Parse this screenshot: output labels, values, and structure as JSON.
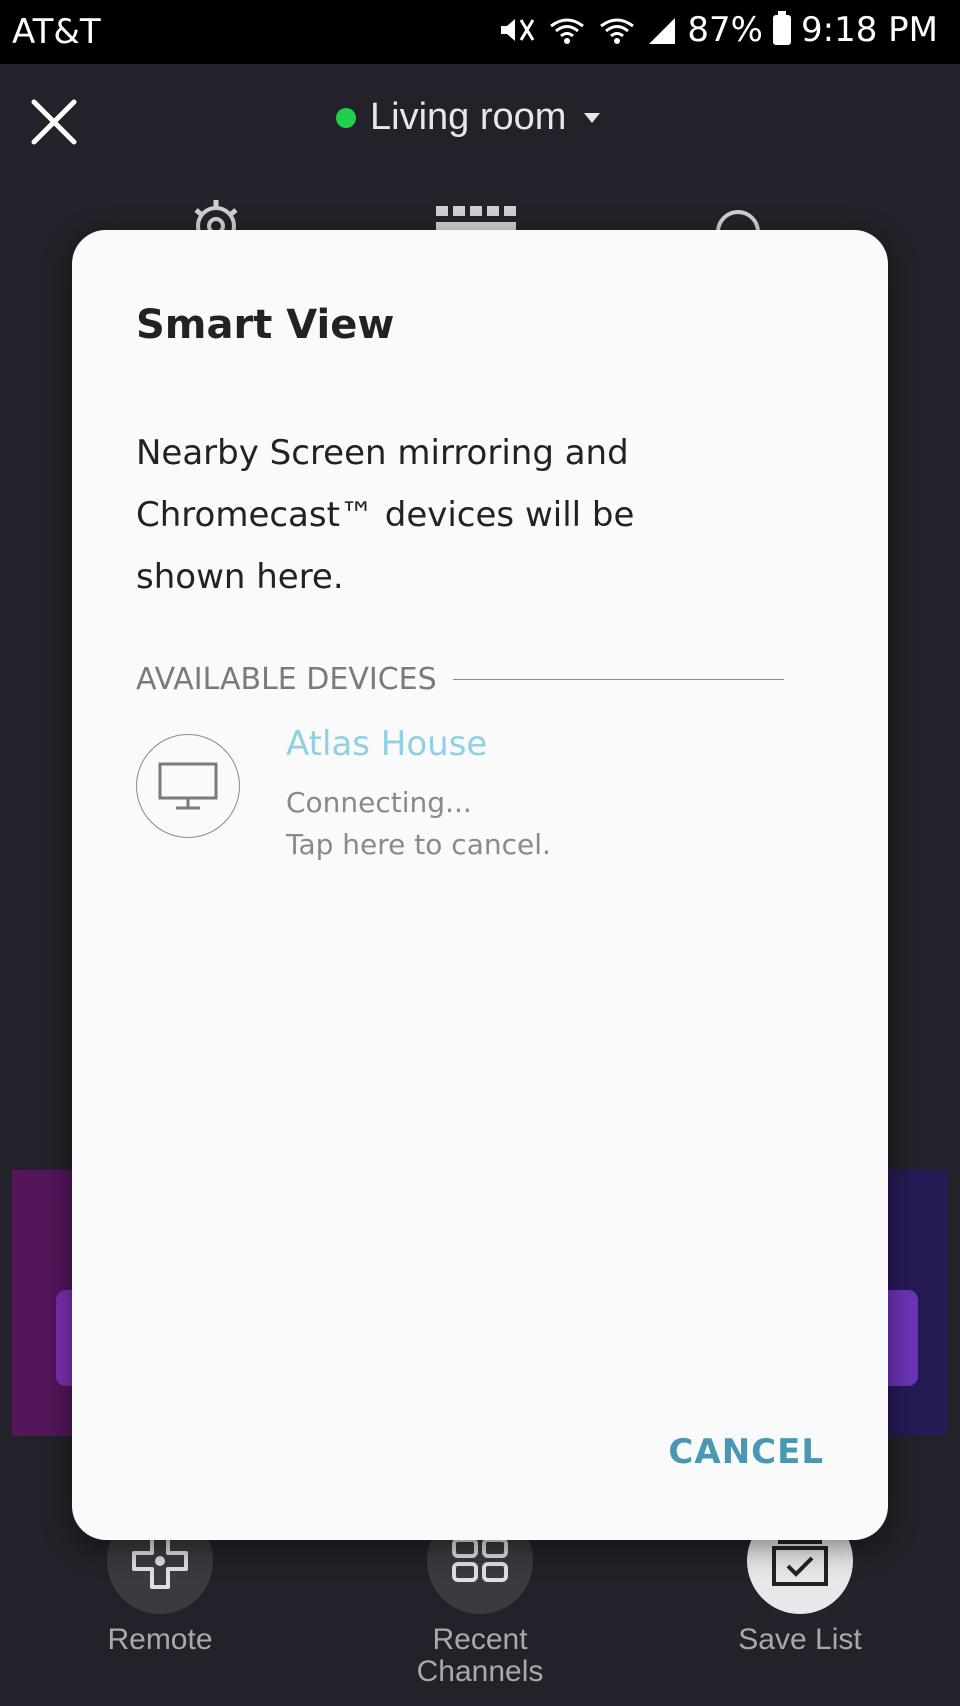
{
  "status_bar": {
    "carrier": "AT&T",
    "battery": "87%",
    "time": "9:18 PM"
  },
  "header": {
    "room": "Living room"
  },
  "dialog": {
    "title": "Smart View",
    "body": "Nearby Screen mirroring and Chromecast™ devices will be shown here.",
    "section_label": "AVAILABLE DEVICES",
    "devices": [
      {
        "name": "Atlas House",
        "status_line1": "Connecting...",
        "status_line2": "Tap here to cancel."
      }
    ],
    "cancel_label": "CANCEL"
  },
  "bottom_nav": {
    "items": [
      {
        "label": "Remote"
      },
      {
        "label": "Recent Channels"
      },
      {
        "label": "Save List"
      }
    ]
  },
  "colors": {
    "status_dot": "#1fd14a",
    "device_name": "#8fd0e4",
    "cancel": "#4b97b3"
  }
}
